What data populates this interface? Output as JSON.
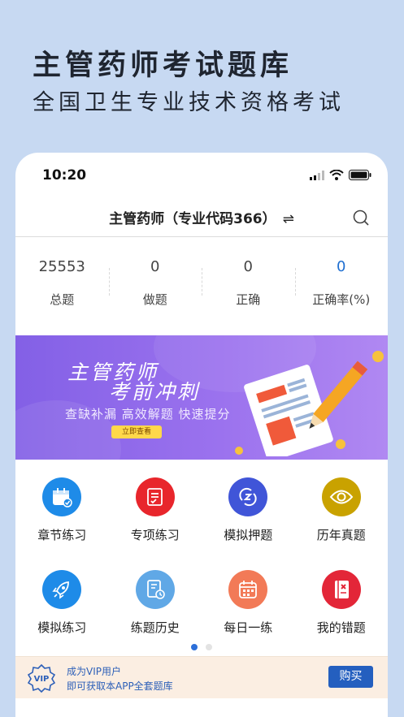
{
  "hero": {
    "title": "主管药师考试题库",
    "subtitle": "全国卫生专业技术资格考试"
  },
  "status_bar": {
    "time": "10:20"
  },
  "nav": {
    "title": "主管药师（专业代码366）",
    "swap_glyph": "⇌"
  },
  "stats": [
    {
      "value": "25553",
      "label": "总题"
    },
    {
      "value": "0",
      "label": "做题"
    },
    {
      "value": "0",
      "label": "正确"
    },
    {
      "value": "0",
      "label": "正确率(%)"
    }
  ],
  "banner": {
    "line1": "主管药师",
    "line2": "考前冲刺",
    "tagline": "查缺补漏 高效解题 快速提分",
    "button": "立即查看"
  },
  "grid": [
    {
      "label": "章节练习",
      "icon": "calendar-check-icon",
      "color": "#1e8be8"
    },
    {
      "label": "专项练习",
      "icon": "checklist-icon",
      "color": "#e8262c"
    },
    {
      "label": "模拟押题",
      "icon": "refresh-z-icon",
      "color": "#4055d8"
    },
    {
      "label": "历年真题",
      "icon": "eye-icon",
      "color": "#c9a200"
    },
    {
      "label": "模拟练习",
      "icon": "rocket-icon",
      "color": "#1e8be8"
    },
    {
      "label": "练题历史",
      "icon": "history-doc-icon",
      "color": "#60a8e6"
    },
    {
      "label": "每日一练",
      "icon": "daily-calendar-icon",
      "color": "#f27a57"
    },
    {
      "label": "我的错题",
      "icon": "error-book-icon",
      "color": "#e32638"
    }
  ],
  "vip": {
    "badge": "VIP",
    "line1": "成为VIP用户",
    "line2": "即可获取本APP全套题库",
    "button": "购买"
  },
  "colors": {
    "background": "#c7d9f2",
    "accent_blue": "#245fbf",
    "banner_purple": "#8a66ea"
  }
}
